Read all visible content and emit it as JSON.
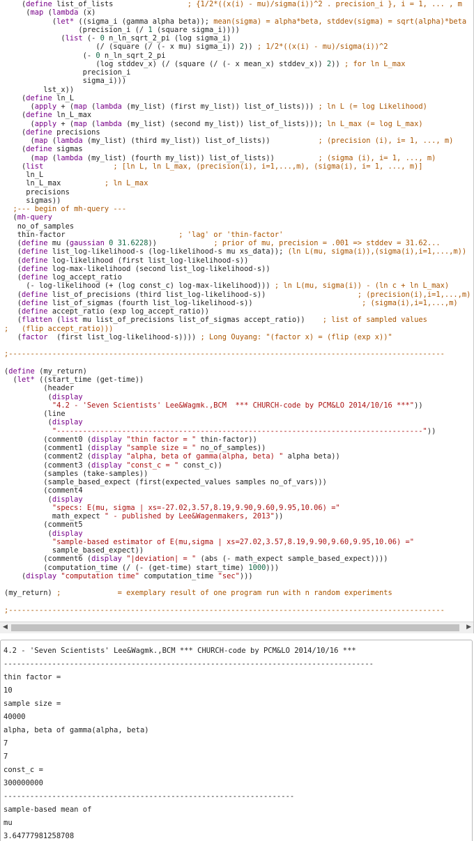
{
  "editor": {
    "lines": [
      [
        [
          "d",
          "    ("
        ],
        [
          "k",
          "define"
        ],
        [
          "d",
          " list_of_lists                 "
        ],
        [
          "c",
          "; {1/2*((x(i) - mu)/sigma(i))^2 . precision_i }, i = 1, ... , m"
        ]
      ],
      [
        [
          "d",
          "     ("
        ],
        [
          "k",
          "map"
        ],
        [
          "d",
          " ("
        ],
        [
          "k",
          "lambda"
        ],
        [
          "d",
          " (x)"
        ]
      ],
      [
        [
          "d",
          "           ("
        ],
        [
          "k",
          "let*"
        ],
        [
          "d",
          " ((sigma_i (gamma alpha beta)); "
        ],
        [
          "c",
          "mean(sigma) = alpha*beta, stddev(sigma) = sqrt(alpha)*beta"
        ]
      ],
      [
        [
          "d",
          "                 (precision_i (/ "
        ],
        [
          "n",
          "1"
        ],
        [
          "d",
          " (square sigma_i))))"
        ]
      ],
      [
        [
          "d",
          "             ("
        ],
        [
          "k",
          "list"
        ],
        [
          "d",
          " (- "
        ],
        [
          "n",
          "0"
        ],
        [
          "d",
          " n_ln_sqrt_2_pi (log sigma_i)"
        ]
      ],
      [
        [
          "d",
          "                     (/ (square (/ (- x mu) sigma_i)) "
        ],
        [
          "n",
          "2"
        ],
        [
          "d",
          ")) "
        ],
        [
          "c",
          "; 1/2*((x(i) - mu)/sigma(i))^2"
        ]
      ],
      [
        [
          "d",
          "                  (- "
        ],
        [
          "n",
          "0"
        ],
        [
          "d",
          " n_ln_sqrt_2_pi"
        ]
      ],
      [
        [
          "d",
          "                     (log stddev_x) (/ (square (/ (- x mean_x) stddev_x)) "
        ],
        [
          "n",
          "2"
        ],
        [
          "d",
          ")) "
        ],
        [
          "c",
          "; for ln L_max"
        ]
      ],
      [
        [
          "d",
          "                  precision_i"
        ]
      ],
      [
        [
          "d",
          "                  sigma_i)))"
        ]
      ],
      [
        [
          "d",
          "         lst_x))"
        ]
      ],
      [
        [
          "d",
          "    ("
        ],
        [
          "k",
          "define"
        ],
        [
          "d",
          " ln_L"
        ]
      ],
      [
        [
          "d",
          "      ("
        ],
        [
          "k",
          "apply"
        ],
        [
          "d",
          " + ("
        ],
        [
          "k",
          "map"
        ],
        [
          "d",
          " ("
        ],
        [
          "k",
          "lambda"
        ],
        [
          "d",
          " (my_list) (first my_list)) list_of_lists))) "
        ],
        [
          "c",
          "; ln L (= log Likelihood)"
        ]
      ],
      [
        [
          "d",
          "    ("
        ],
        [
          "k",
          "define"
        ],
        [
          "d",
          " ln_L_max"
        ]
      ],
      [
        [
          "d",
          "      ("
        ],
        [
          "k",
          "apply"
        ],
        [
          "d",
          " + ("
        ],
        [
          "k",
          "map"
        ],
        [
          "d",
          " ("
        ],
        [
          "k",
          "lambda"
        ],
        [
          "d",
          " (my_list) (second my_list)) list_of_lists))); "
        ],
        [
          "c",
          "ln L_max (= log L_max)"
        ]
      ],
      [
        [
          "d",
          "    ("
        ],
        [
          "k",
          "define"
        ],
        [
          "d",
          " precisions"
        ]
      ],
      [
        [
          "d",
          "      ("
        ],
        [
          "k",
          "map"
        ],
        [
          "d",
          " ("
        ],
        [
          "k",
          "lambda"
        ],
        [
          "d",
          " (my_list) (third my_list)) list_of_lists))           "
        ],
        [
          "c",
          "; (precision (i), i= 1, ..., m)"
        ]
      ],
      [
        [
          "d",
          "    ("
        ],
        [
          "k",
          "define"
        ],
        [
          "d",
          " sigmas"
        ]
      ],
      [
        [
          "d",
          "      ("
        ],
        [
          "k",
          "map"
        ],
        [
          "d",
          " ("
        ],
        [
          "k",
          "lambda"
        ],
        [
          "d",
          " (my_list) (fourth my_list)) list_of_lists))          "
        ],
        [
          "c",
          "; (sigma (i), i= 1, ..., m)"
        ]
      ],
      [
        [
          "d",
          "    ("
        ],
        [
          "k",
          "list"
        ],
        [
          "d",
          "                "
        ],
        [
          "c",
          "; [ln L, ln L_max, (precision(i), i=1,...,m), (sigma(i), i= 1, ..., m)]"
        ]
      ],
      [
        [
          "d",
          "     ln_L"
        ]
      ],
      [
        [
          "d",
          "     ln_L_max          "
        ],
        [
          "c",
          "; ln L_max"
        ]
      ],
      [
        [
          "d",
          "     precisions"
        ]
      ],
      [
        [
          "d",
          "     sigmas))"
        ]
      ],
      [
        [
          "c",
          "  ;--- begin of mh-query ---"
        ]
      ],
      [
        [
          "d",
          "  ("
        ],
        [
          "k",
          "mh-query"
        ]
      ],
      [
        [
          "d",
          "   no_of_samples"
        ]
      ],
      [
        [
          "d",
          "   thin-factor                          "
        ],
        [
          "c",
          "; 'lag' or 'thin-factor'"
        ]
      ],
      [
        [
          "d",
          "   ("
        ],
        [
          "k",
          "define"
        ],
        [
          "d",
          " mu ("
        ],
        [
          "k",
          "gaussian"
        ],
        [
          "d",
          " "
        ],
        [
          "n",
          "0"
        ],
        [
          "d",
          " "
        ],
        [
          "n",
          "31.6228"
        ],
        [
          "d",
          "))             "
        ],
        [
          "c",
          "; prior of mu, precision = .001 => stddev = 31.62..."
        ]
      ],
      [
        [
          "d",
          "   ("
        ],
        [
          "k",
          "define"
        ],
        [
          "d",
          " list_log-likelihood-s (log-likelihood-s mu xs_data)); "
        ],
        [
          "c",
          "(ln L(mu, sigma(i)),(sigma(i),i=1,...,m))"
        ]
      ],
      [
        [
          "d",
          "   ("
        ],
        [
          "k",
          "define"
        ],
        [
          "d",
          " log-likelihood (first list_log-likelihood-s))"
        ]
      ],
      [
        [
          "d",
          "   ("
        ],
        [
          "k",
          "define"
        ],
        [
          "d",
          " log-max-likelihood (second list_log-likelihood-s))"
        ]
      ],
      [
        [
          "d",
          "   ("
        ],
        [
          "k",
          "define"
        ],
        [
          "d",
          " log_accept_ratio"
        ]
      ],
      [
        [
          "d",
          "     (- log-likelihood (+ (log const_c) log-max-likelihood))) "
        ],
        [
          "c",
          "; ln L(mu, sigma(i)) - (ln c + ln L_max)"
        ]
      ],
      [
        [
          "d",
          "   ("
        ],
        [
          "k",
          "define"
        ],
        [
          "d",
          " list_of_precisions (third list_log-likelihood-s))                     "
        ],
        [
          "c",
          "; (precision(i),i=1,...,m)"
        ]
      ],
      [
        [
          "d",
          "   ("
        ],
        [
          "k",
          "define"
        ],
        [
          "d",
          " list_of_sigmas (fourth list_log-likelihood-s))                         "
        ],
        [
          "c",
          "; (sigma(i),i=1,...,m)"
        ]
      ],
      [
        [
          "d",
          "   ("
        ],
        [
          "k",
          "define"
        ],
        [
          "d",
          " accept_ratio (exp log_accept_ratio))"
        ]
      ],
      [
        [
          "d",
          "   ("
        ],
        [
          "k",
          "flatten"
        ],
        [
          "d",
          " ("
        ],
        [
          "k",
          "list"
        ],
        [
          "d",
          " mu list_of_precisions list_of_sigmas accept_ratio))    "
        ],
        [
          "c",
          "; list of sampled values"
        ]
      ],
      [
        [
          "c",
          ";   (flip accept_ratio)))"
        ]
      ],
      [
        [
          "d",
          "   ("
        ],
        [
          "k",
          "factor"
        ],
        [
          "d",
          "  (first list_log-likelihood-s)))) "
        ],
        [
          "c",
          "; Long Ouyang: \"(factor x) = (flip (exp x))\""
        ]
      ],
      [
        [
          "d",
          ""
        ]
      ],
      [
        [
          "c",
          ";----------------------------------------------------------------------------------------------------"
        ]
      ],
      [
        [
          "d",
          ""
        ]
      ],
      [
        [
          "d",
          "("
        ],
        [
          "k",
          "define"
        ],
        [
          "d",
          " (my_return)"
        ]
      ],
      [
        [
          "d",
          "  ("
        ],
        [
          "k",
          "let*"
        ],
        [
          "d",
          " ((start_time (get-time))"
        ]
      ],
      [
        [
          "d",
          "         (header"
        ]
      ],
      [
        [
          "d",
          "          ("
        ],
        [
          "k",
          "display"
        ]
      ],
      [
        [
          "d",
          "           "
        ],
        [
          "s",
          "\"4.2 - 'Seven Scientists' Lee&Wagmk.,BCM  *** CHURCH-code by PCM&LO 2014/10/16 ***\""
        ],
        [
          "d",
          "))"
        ]
      ],
      [
        [
          "d",
          "         (line"
        ]
      ],
      [
        [
          "d",
          "          ("
        ],
        [
          "k",
          "display"
        ]
      ],
      [
        [
          "d",
          "           "
        ],
        [
          "s",
          "\"------------------------------------------------------------------------------------\""
        ],
        [
          "d",
          "))"
        ]
      ],
      [
        [
          "d",
          "         (comment0 ("
        ],
        [
          "k",
          "display"
        ],
        [
          "d",
          " "
        ],
        [
          "s",
          "\"thin factor = \""
        ],
        [
          "d",
          " thin-factor))"
        ]
      ],
      [
        [
          "d",
          "         (comment1 ("
        ],
        [
          "k",
          "display"
        ],
        [
          "d",
          " "
        ],
        [
          "s",
          "\"sample size = \""
        ],
        [
          "d",
          " no_of_samples))"
        ]
      ],
      [
        [
          "d",
          "         (comment2 ("
        ],
        [
          "k",
          "display"
        ],
        [
          "d",
          " "
        ],
        [
          "s",
          "\"alpha, beta of gamma(alpha, beta) \""
        ],
        [
          "d",
          " alpha beta))"
        ]
      ],
      [
        [
          "d",
          "         (comment3 ("
        ],
        [
          "k",
          "display"
        ],
        [
          "d",
          " "
        ],
        [
          "s",
          "\"const_c = \""
        ],
        [
          "d",
          " const_c))"
        ]
      ],
      [
        [
          "d",
          "         (samples (take-samples))"
        ]
      ],
      [
        [
          "d",
          "         (sample_based_expect (first(expected_values samples no_of_vars)))"
        ]
      ],
      [
        [
          "d",
          "         (comment4"
        ]
      ],
      [
        [
          "d",
          "          ("
        ],
        [
          "k",
          "display"
        ]
      ],
      [
        [
          "d",
          "           "
        ],
        [
          "s",
          "\"specs: E(mu, sigma | xs=-27.02,3.57,8.19,9.90,9.60,9.95,10.06) =\""
        ]
      ],
      [
        [
          "d",
          "           math_expect "
        ],
        [
          "s",
          "\" - published by Lee&Wagenmakers, 2013\""
        ],
        [
          "d",
          "))"
        ]
      ],
      [
        [
          "d",
          "         (comment5"
        ]
      ],
      [
        [
          "d",
          "          ("
        ],
        [
          "k",
          "display"
        ]
      ],
      [
        [
          "d",
          "           "
        ],
        [
          "s",
          "\"sample-based estimator of E(mu,sigma | xs=27.02,3.57,8.19,9.90,9.60,9.95,10.06) =\""
        ]
      ],
      [
        [
          "d",
          "           sample_based_expect))"
        ]
      ],
      [
        [
          "d",
          "         (comment6 ("
        ],
        [
          "k",
          "display"
        ],
        [
          "d",
          " "
        ],
        [
          "s",
          "\"|deviation| = \""
        ],
        [
          "d",
          " (abs (- math_expect sample_based_expect))))"
        ]
      ],
      [
        [
          "d",
          "         (computation_time (/ (- (get-time) start_time) "
        ],
        [
          "n",
          "1000"
        ],
        [
          "d",
          ")))"
        ]
      ],
      [
        [
          "d",
          "    ("
        ],
        [
          "k",
          "display"
        ],
        [
          "d",
          " "
        ],
        [
          "s",
          "\"computation time\""
        ],
        [
          "d",
          " computation_time "
        ],
        [
          "s",
          "\"sec\""
        ],
        [
          "d",
          ")))"
        ]
      ],
      [
        [
          "d",
          ""
        ]
      ],
      [
        [
          "d",
          "(my_return) "
        ],
        [
          "c",
          ";             = exemplary result of one program run with n random experiments"
        ]
      ],
      [
        [
          "d",
          ""
        ]
      ],
      [
        [
          "c",
          ";----------------------------------------------------------------------------------------------------"
        ]
      ]
    ]
  },
  "scrollbar": {
    "left_arrow": "◀",
    "right_arrow": "▶"
  },
  "output": {
    "lines": [
      "4.2 - 'Seven Scientists' Lee&Wagmk.,BCM *** CHURCH-code by PCM&LO 2014/10/16 ***",
      "------------------------------------------------------------------------------------",
      "thin factor =",
      "10",
      "sample size =",
      "40000",
      "alpha, beta of gamma(alpha, beta)",
      "7",
      "7",
      "const_c =",
      "300000000",
      "------------------------------------------------------------------",
      "sample-based mean of",
      "mu",
      "3.64777981258708"
    ]
  }
}
